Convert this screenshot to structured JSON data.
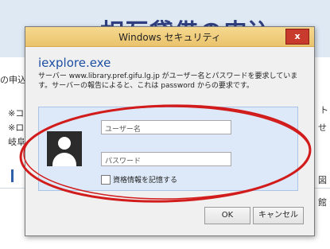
{
  "background": {
    "page_title": "相互貸借の申込",
    "left_fragments": [
      "の申込",
      "※コ",
      "※ロ",
      "岐阜",
      "■"
    ],
    "right_fragments": [
      "ト",
      "せ",
      "図",
      "館"
    ]
  },
  "dialog": {
    "title": "Windows セキュリティ",
    "close_glyph": "x",
    "app_name": "iexplore.exe",
    "message": "サーバー www.library.pref.gifu.lg.jp がユーザー名とパスワードを要求しています。サーバーの報告によると、これは password からの要求です。",
    "username_placeholder": "ユーザー名",
    "password_placeholder": "パスワード",
    "remember_label": "資格情報を記憶する",
    "ok_label": "OK",
    "cancel_label": "キャンセル",
    "avatar_icon": "user-silhouette-icon"
  },
  "colors": {
    "titlebar": "#eac36d",
    "close_button": "#c73a2c",
    "app_name": "#1c4fa3",
    "credential_panel": "#dde9f8",
    "annotation": "#d21c1c",
    "page_title": "#2f3f7f"
  }
}
